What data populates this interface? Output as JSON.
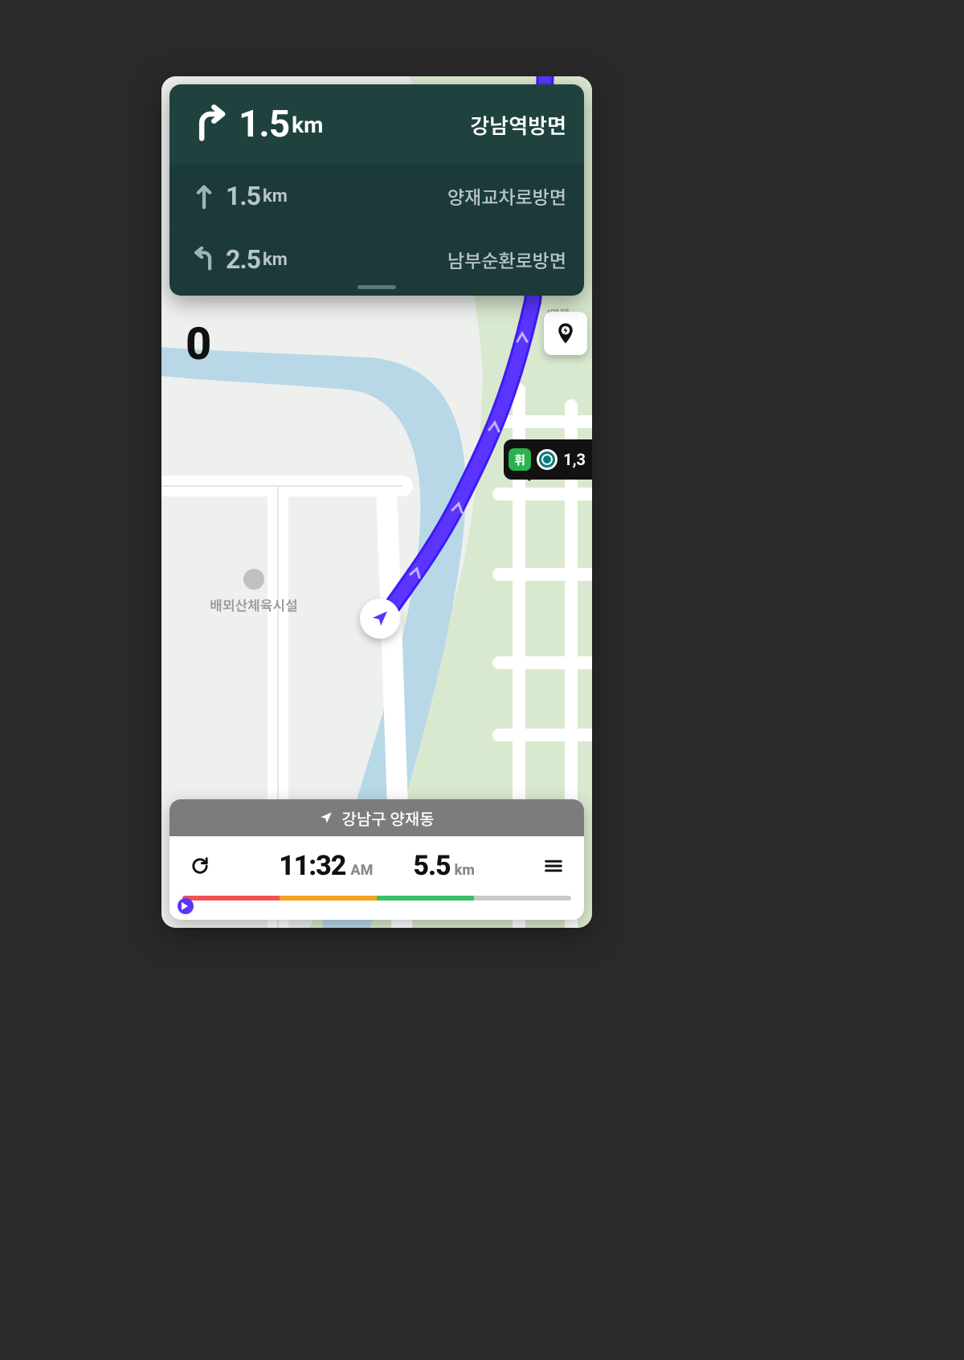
{
  "directions": {
    "main": {
      "distance": "1.5",
      "unit": "km",
      "destination": "강남역방면",
      "icon": "turn-right"
    },
    "upcoming": [
      {
        "distance": "1.5",
        "unit": "km",
        "destination": "양재교차로방면",
        "icon": "straight"
      },
      {
        "distance": "2.5",
        "unit": "km",
        "destination": "남부순환로방면",
        "icon": "turn-left"
      }
    ]
  },
  "speed": {
    "value": "0"
  },
  "map": {
    "poi_sports": "배뫼산체육시설",
    "poi_top_right": "!면제",
    "fuel": {
      "badge": "휘",
      "price_partial": "1,3"
    }
  },
  "eta": {
    "location": "강남구 양재동",
    "time": "11:32",
    "ampm": "AM",
    "dist": "5.5",
    "dist_unit": "km"
  },
  "colors": {
    "route": "#4a2cff",
    "panel_main": "#1f423f",
    "panel_sub": "#1c3a3a"
  }
}
